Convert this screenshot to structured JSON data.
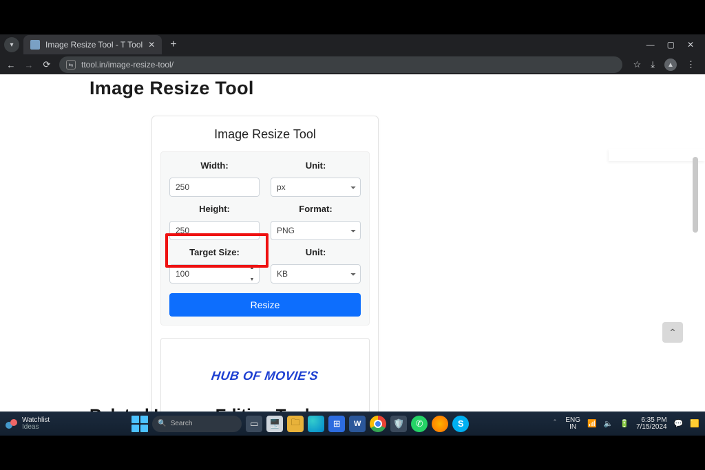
{
  "browser": {
    "tab_title": "Image Resize Tool - T Tool",
    "url": "ttool.in/image-resize-tool/"
  },
  "window_controls": {
    "minimize": "—",
    "maximize": "▢",
    "close": "✕"
  },
  "page": {
    "heading": "Image Resize Tool",
    "card_title": "Image Resize Tool",
    "related_heading": "Related Images Editing Tool",
    "form": {
      "width_label": "Width:",
      "width_value": "250",
      "unit1_label": "Unit:",
      "unit1_value": "px",
      "height_label": "Height:",
      "height_value": "250",
      "format_label": "Format:",
      "format_value": "PNG",
      "target_label": "Target Size:",
      "target_value": "100",
      "unit2_label": "Unit:",
      "unit2_value": "KB",
      "button": "Resize"
    },
    "preview_text": "HUB OF MOVIE'S"
  },
  "taskbar": {
    "widget_title": "Watchlist",
    "widget_sub": "Ideas",
    "search_placeholder": "Search",
    "lang_top": "ENG",
    "lang_bottom": "IN",
    "time": "6:35 PM",
    "date": "7/15/2024"
  }
}
